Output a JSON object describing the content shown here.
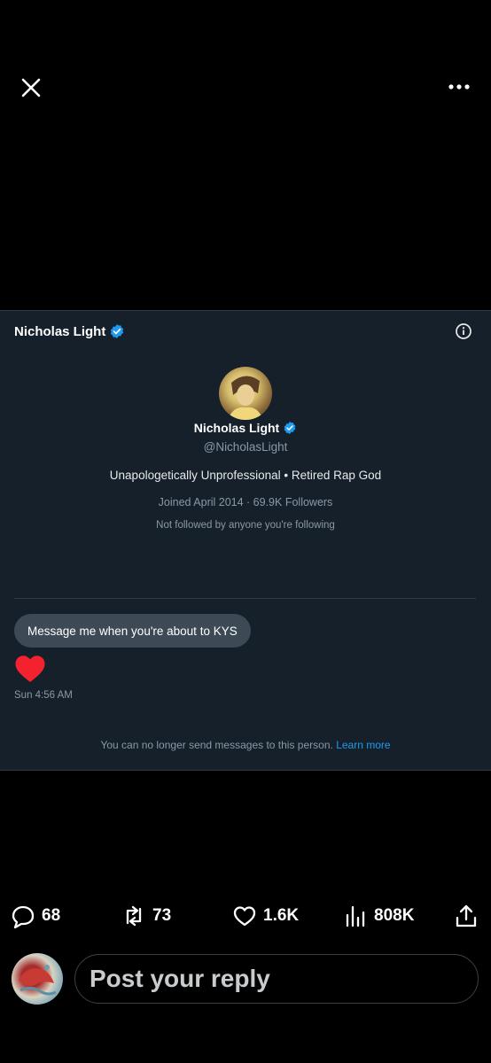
{
  "top_bar": {
    "close_icon": "close-icon",
    "more_icon": "more-icon"
  },
  "card": {
    "header_name": "Nicholas Light",
    "profile": {
      "name": "Nicholas Light",
      "handle": "@NicholasLight",
      "bio": "Unapologetically Unprofessional • Retired Rap God",
      "meta": "Joined April 2014 · 69.9K Followers",
      "mutual": "Not followed by anyone you're following"
    },
    "message": {
      "text": "Message me when you're about to KYS",
      "reaction": "heart-icon",
      "timestamp": "Sun 4:56 AM"
    },
    "notice": "You can no longer send messages to this person.",
    "learn_more": "Learn more"
  },
  "actions": {
    "replies": "68",
    "reposts": "73",
    "likes": "1.6K",
    "views": "808K"
  },
  "reply": {
    "placeholder": "Post your reply"
  },
  "colors": {
    "accent": "#1d9bf0",
    "card_bg": "#15202b",
    "heart": "#f4212e"
  }
}
